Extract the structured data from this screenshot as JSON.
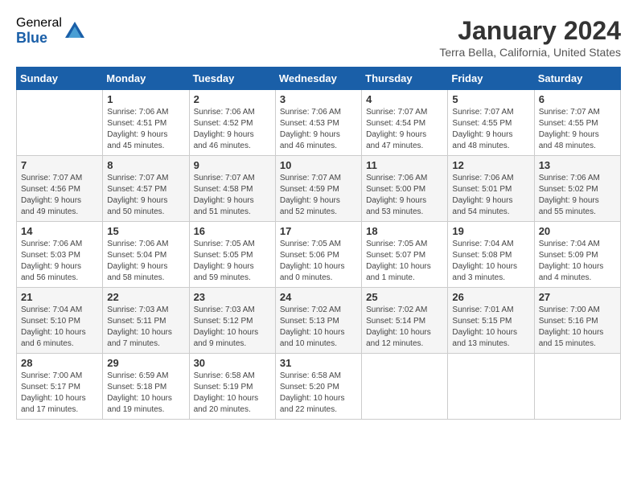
{
  "logo": {
    "general": "General",
    "blue": "Blue"
  },
  "title": "January 2024",
  "location": "Terra Bella, California, United States",
  "weekdays": [
    "Sunday",
    "Monday",
    "Tuesday",
    "Wednesday",
    "Thursday",
    "Friday",
    "Saturday"
  ],
  "weeks": [
    [
      {
        "day": "",
        "info": ""
      },
      {
        "day": "1",
        "info": "Sunrise: 7:06 AM\nSunset: 4:51 PM\nDaylight: 9 hours\nand 45 minutes."
      },
      {
        "day": "2",
        "info": "Sunrise: 7:06 AM\nSunset: 4:52 PM\nDaylight: 9 hours\nand 46 minutes."
      },
      {
        "day": "3",
        "info": "Sunrise: 7:06 AM\nSunset: 4:53 PM\nDaylight: 9 hours\nand 46 minutes."
      },
      {
        "day": "4",
        "info": "Sunrise: 7:07 AM\nSunset: 4:54 PM\nDaylight: 9 hours\nand 47 minutes."
      },
      {
        "day": "5",
        "info": "Sunrise: 7:07 AM\nSunset: 4:55 PM\nDaylight: 9 hours\nand 48 minutes."
      },
      {
        "day": "6",
        "info": "Sunrise: 7:07 AM\nSunset: 4:55 PM\nDaylight: 9 hours\nand 48 minutes."
      }
    ],
    [
      {
        "day": "7",
        "info": "Sunrise: 7:07 AM\nSunset: 4:56 PM\nDaylight: 9 hours\nand 49 minutes."
      },
      {
        "day": "8",
        "info": "Sunrise: 7:07 AM\nSunset: 4:57 PM\nDaylight: 9 hours\nand 50 minutes."
      },
      {
        "day": "9",
        "info": "Sunrise: 7:07 AM\nSunset: 4:58 PM\nDaylight: 9 hours\nand 51 minutes."
      },
      {
        "day": "10",
        "info": "Sunrise: 7:07 AM\nSunset: 4:59 PM\nDaylight: 9 hours\nand 52 minutes."
      },
      {
        "day": "11",
        "info": "Sunrise: 7:06 AM\nSunset: 5:00 PM\nDaylight: 9 hours\nand 53 minutes."
      },
      {
        "day": "12",
        "info": "Sunrise: 7:06 AM\nSunset: 5:01 PM\nDaylight: 9 hours\nand 54 minutes."
      },
      {
        "day": "13",
        "info": "Sunrise: 7:06 AM\nSunset: 5:02 PM\nDaylight: 9 hours\nand 55 minutes."
      }
    ],
    [
      {
        "day": "14",
        "info": "Sunrise: 7:06 AM\nSunset: 5:03 PM\nDaylight: 9 hours\nand 56 minutes."
      },
      {
        "day": "15",
        "info": "Sunrise: 7:06 AM\nSunset: 5:04 PM\nDaylight: 9 hours\nand 58 minutes."
      },
      {
        "day": "16",
        "info": "Sunrise: 7:05 AM\nSunset: 5:05 PM\nDaylight: 9 hours\nand 59 minutes."
      },
      {
        "day": "17",
        "info": "Sunrise: 7:05 AM\nSunset: 5:06 PM\nDaylight: 10 hours\nand 0 minutes."
      },
      {
        "day": "18",
        "info": "Sunrise: 7:05 AM\nSunset: 5:07 PM\nDaylight: 10 hours\nand 1 minute."
      },
      {
        "day": "19",
        "info": "Sunrise: 7:04 AM\nSunset: 5:08 PM\nDaylight: 10 hours\nand 3 minutes."
      },
      {
        "day": "20",
        "info": "Sunrise: 7:04 AM\nSunset: 5:09 PM\nDaylight: 10 hours\nand 4 minutes."
      }
    ],
    [
      {
        "day": "21",
        "info": "Sunrise: 7:04 AM\nSunset: 5:10 PM\nDaylight: 10 hours\nand 6 minutes."
      },
      {
        "day": "22",
        "info": "Sunrise: 7:03 AM\nSunset: 5:11 PM\nDaylight: 10 hours\nand 7 minutes."
      },
      {
        "day": "23",
        "info": "Sunrise: 7:03 AM\nSunset: 5:12 PM\nDaylight: 10 hours\nand 9 minutes."
      },
      {
        "day": "24",
        "info": "Sunrise: 7:02 AM\nSunset: 5:13 PM\nDaylight: 10 hours\nand 10 minutes."
      },
      {
        "day": "25",
        "info": "Sunrise: 7:02 AM\nSunset: 5:14 PM\nDaylight: 10 hours\nand 12 minutes."
      },
      {
        "day": "26",
        "info": "Sunrise: 7:01 AM\nSunset: 5:15 PM\nDaylight: 10 hours\nand 13 minutes."
      },
      {
        "day": "27",
        "info": "Sunrise: 7:00 AM\nSunset: 5:16 PM\nDaylight: 10 hours\nand 15 minutes."
      }
    ],
    [
      {
        "day": "28",
        "info": "Sunrise: 7:00 AM\nSunset: 5:17 PM\nDaylight: 10 hours\nand 17 minutes."
      },
      {
        "day": "29",
        "info": "Sunrise: 6:59 AM\nSunset: 5:18 PM\nDaylight: 10 hours\nand 19 minutes."
      },
      {
        "day": "30",
        "info": "Sunrise: 6:58 AM\nSunset: 5:19 PM\nDaylight: 10 hours\nand 20 minutes."
      },
      {
        "day": "31",
        "info": "Sunrise: 6:58 AM\nSunset: 5:20 PM\nDaylight: 10 hours\nand 22 minutes."
      },
      {
        "day": "",
        "info": ""
      },
      {
        "day": "",
        "info": ""
      },
      {
        "day": "",
        "info": ""
      }
    ]
  ]
}
